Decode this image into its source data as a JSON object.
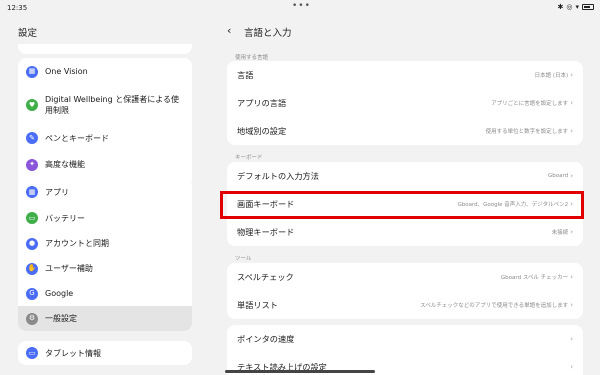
{
  "status": {
    "time": "12:35",
    "dots": "•••"
  },
  "left": {
    "title": "設定",
    "items": [
      {
        "label": "One Vision",
        "icon": "grid-icon",
        "color": "#4a6cf7"
      },
      {
        "label": "Digital Wellbeing と保護者による使用制限",
        "icon": "wellbeing-icon",
        "color": "#3fae49"
      },
      {
        "label": "ペンとキーボード",
        "icon": "pen-icon",
        "color": "#4a6cf7"
      },
      {
        "label": "高度な機能",
        "icon": "advanced-icon",
        "color": "#8a55d9"
      },
      {
        "label": "アプリ",
        "icon": "apps-icon",
        "color": "#4a6cf7"
      },
      {
        "label": "バッテリー",
        "icon": "battery-icon",
        "color": "#3fae49"
      },
      {
        "label": "アカウントと同期",
        "icon": "account-icon",
        "color": "#4a6cf7"
      },
      {
        "label": "ユーザー補助",
        "icon": "accessibility-icon",
        "color": "#4a6cf7"
      },
      {
        "label": "Google",
        "icon": "google-icon",
        "color": "#4a6cf7"
      },
      {
        "label": "一般設定",
        "icon": "general-settings-icon",
        "color": "#8a8a8a"
      },
      {
        "label": "タブレット情報",
        "icon": "tablet-info-icon",
        "color": "#4a6cf7"
      }
    ]
  },
  "right": {
    "title": "言語と入力",
    "sections": [
      {
        "header": "使用する言語"
      },
      {
        "header": "キーボード"
      },
      {
        "header": "ツール"
      }
    ],
    "rows": [
      {
        "label": "言語",
        "value": "日本語 (日本)"
      },
      {
        "label": "アプリの言語",
        "value": "アプリごとに言語を設定します"
      },
      {
        "label": "地域別の設定",
        "value": "使用する単位と数字を設定します"
      },
      {
        "label": "デフォルトの入力方法",
        "value": "Gboard"
      },
      {
        "label": "画面キーボード",
        "value": "Gboard、Google 音声入力、デジタルペン2"
      },
      {
        "label": "物理キーボード",
        "value": "未接続"
      },
      {
        "label": "スペルチェック",
        "value": "Gboard スペル チェッカー"
      },
      {
        "label": "単語リスト",
        "value": "スペルチェックなどのアプリで使用できる単語を追加します"
      },
      {
        "label": "ポインタの速度",
        "value": ""
      },
      {
        "label": "テキスト読み上げの設定",
        "value": ""
      }
    ]
  },
  "colors": {
    "highlight": "#e00000",
    "background": "#f2f2f2",
    "card": "#ffffff"
  }
}
